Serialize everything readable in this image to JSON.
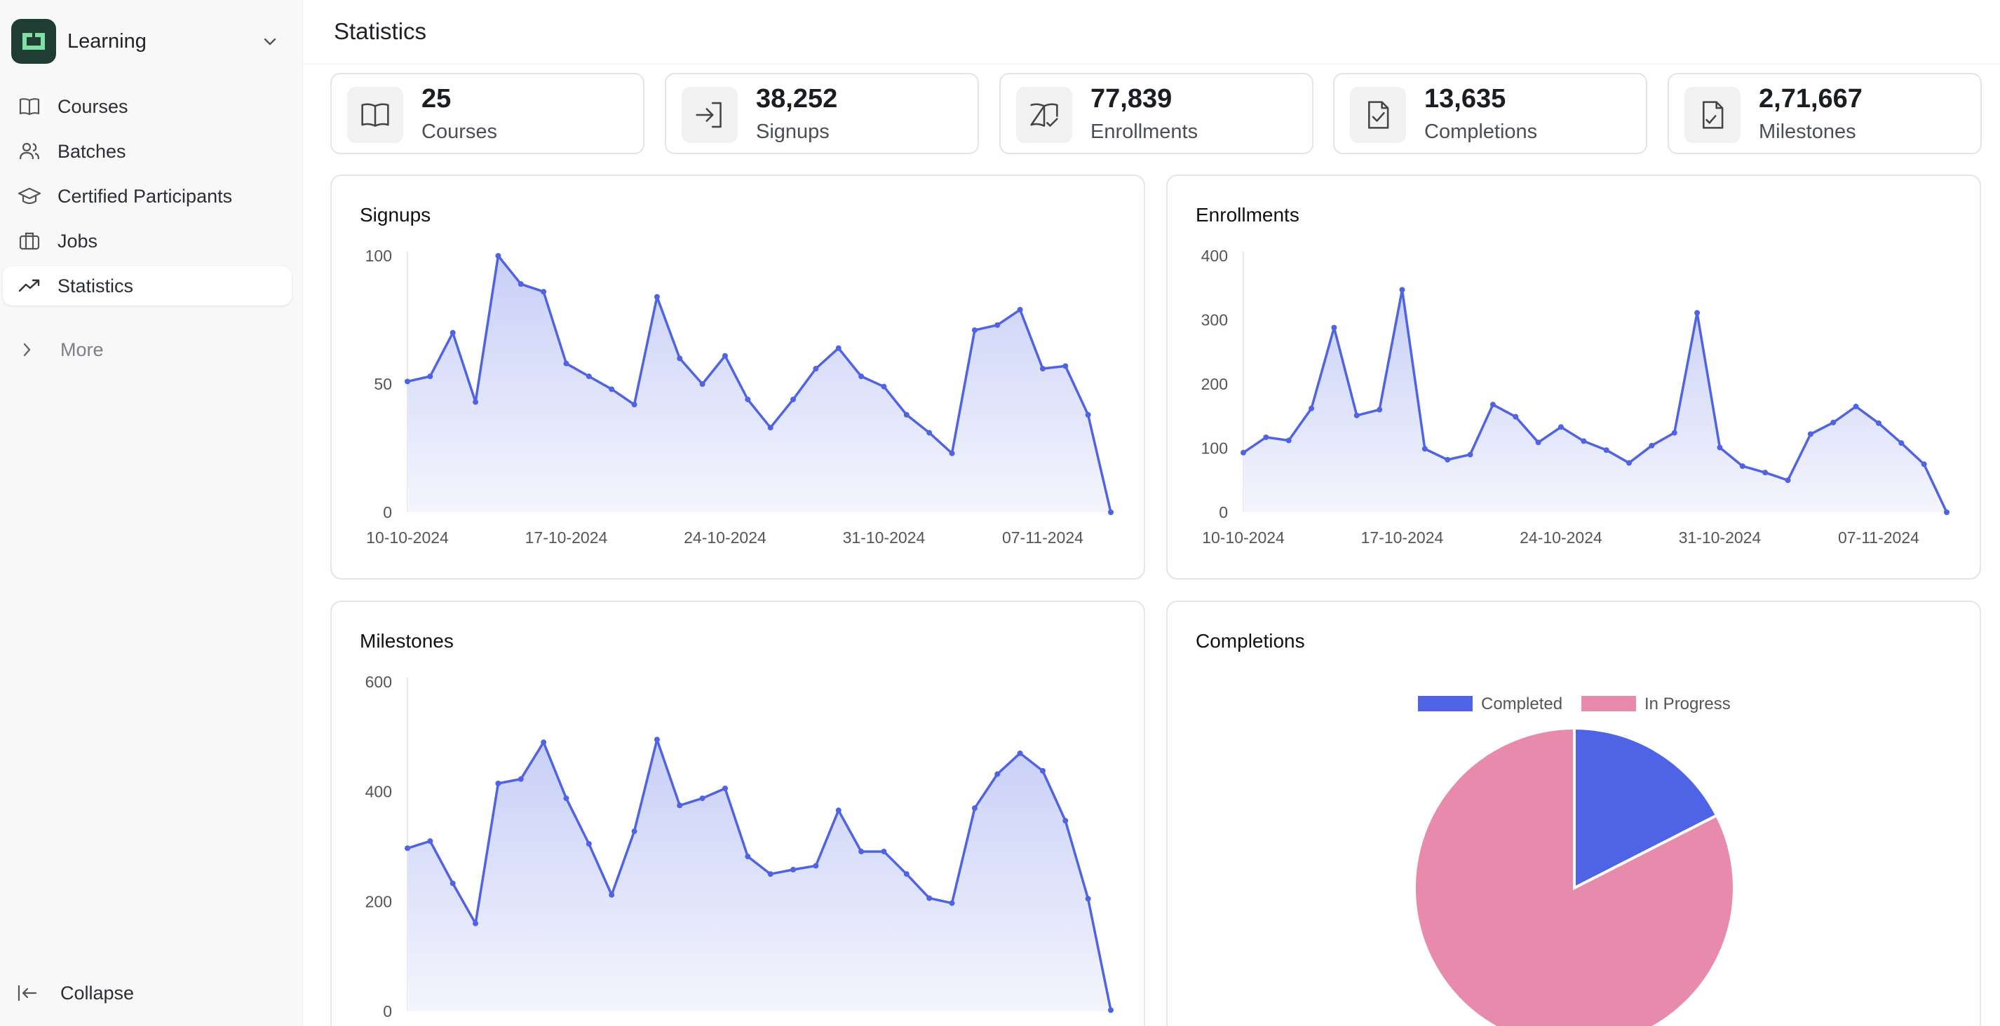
{
  "app": {
    "name": "Learning"
  },
  "sidebar": {
    "items": [
      {
        "label": "Courses",
        "icon": "book-icon"
      },
      {
        "label": "Batches",
        "icon": "users-icon"
      },
      {
        "label": "Certified Participants",
        "icon": "graduation-cap-icon"
      },
      {
        "label": "Jobs",
        "icon": "briefcase-icon"
      },
      {
        "label": "Statistics",
        "icon": "trending-up-icon",
        "active": true
      }
    ],
    "more_label": "More",
    "collapse_label": "Collapse"
  },
  "header": {
    "title": "Statistics"
  },
  "stats": [
    {
      "value": "25",
      "label": "Courses",
      "icon": "book-icon"
    },
    {
      "value": "38,252",
      "label": "Signups",
      "icon": "sign-in-icon"
    },
    {
      "value": "77,839",
      "label": "Enrollments",
      "icon": "book-check-icon"
    },
    {
      "value": "13,635",
      "label": "Completions",
      "icon": "file-check-icon"
    },
    {
      "value": "2,71,667",
      "label": "Milestones",
      "icon": "file-signature-icon"
    }
  ],
  "colors": {
    "line": "#4f63e3",
    "completed": "#4e63e5",
    "in_progress": "#e88aac",
    "area_top": "#c8cff7",
    "area_bottom": "#f4f5fd"
  },
  "chart_data": [
    {
      "title": "Signups",
      "type": "area",
      "x_ticks": [
        "10-10-2024",
        "17-10-2024",
        "24-10-2024",
        "31-10-2024",
        "07-11-2024"
      ],
      "ylim": [
        0,
        100
      ],
      "y_ticks": [
        0,
        50,
        100
      ],
      "values": [
        51,
        53,
        70,
        43,
        100,
        89,
        86,
        58,
        53,
        48,
        42,
        84,
        60,
        50,
        61,
        44,
        33,
        44,
        56,
        64,
        53,
        49,
        38,
        31,
        23,
        71,
        73,
        79,
        56,
        57,
        38,
        0
      ]
    },
    {
      "title": "Enrollments",
      "type": "area",
      "x_ticks": [
        "10-10-2024",
        "17-10-2024",
        "24-10-2024",
        "31-10-2024",
        "07-11-2024"
      ],
      "ylim": [
        0,
        400
      ],
      "y_ticks": [
        0,
        100,
        200,
        300,
        400
      ],
      "values": [
        93,
        117,
        112,
        162,
        288,
        151,
        160,
        347,
        99,
        82,
        90,
        168,
        149,
        109,
        133,
        111,
        97,
        77,
        104,
        124,
        311,
        101,
        72,
        62,
        50,
        122,
        140,
        165,
        139,
        108,
        75,
        0
      ]
    },
    {
      "title": "Milestones",
      "type": "area",
      "x_ticks": [],
      "ylim": [
        0,
        600
      ],
      "y_ticks": [
        0,
        200,
        400,
        600
      ],
      "values": [
        297,
        310,
        233,
        160,
        415,
        423,
        490,
        388,
        305,
        212,
        328,
        495,
        375,
        388,
        406,
        282,
        250,
        258,
        265,
        366,
        291,
        291,
        250,
        206,
        197,
        370,
        432,
        470,
        438,
        347,
        205,
        2
      ]
    },
    {
      "title": "Completions",
      "type": "pie",
      "labels": [
        "Completed",
        "In Progress"
      ],
      "values": [
        17.5,
        82.5
      ]
    }
  ]
}
